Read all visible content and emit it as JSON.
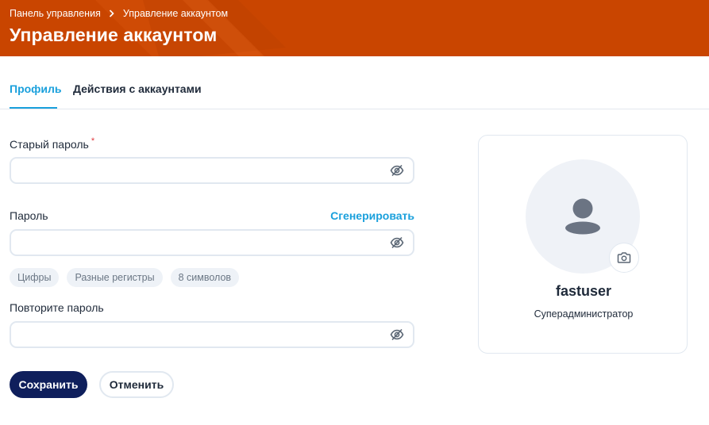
{
  "header": {
    "breadcrumb": [
      "Панель управления",
      "Управление аккаунтом"
    ],
    "title": "Управление аккаунтом",
    "background_color": "#c94500"
  },
  "tabs": [
    {
      "label": "Профиль",
      "active": true
    },
    {
      "label": "Действия с аккаунтами",
      "active": false
    }
  ],
  "form": {
    "old_password": {
      "label": "Старый пароль",
      "required_mark": "*",
      "value": ""
    },
    "password": {
      "label": "Пароль",
      "value": "",
      "generate_label": "Сгенерировать"
    },
    "requirements": [
      "Цифры",
      "Разные регистры",
      "8 символов"
    ],
    "repeat_password": {
      "label": "Повторите пароль",
      "value": ""
    }
  },
  "actions": {
    "save_label": "Сохранить",
    "cancel_label": "Отменить"
  },
  "profile": {
    "username": "fastuser",
    "role": "Суперадминистратор"
  },
  "colors": {
    "accent": "#1aa0dc",
    "primary_button": "#0f1f5c"
  }
}
